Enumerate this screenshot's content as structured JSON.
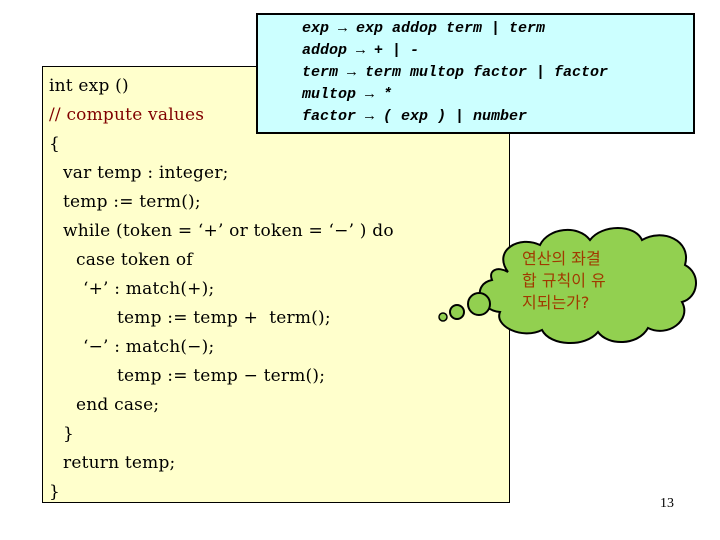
{
  "grammar": {
    "lines": [
      "exp → exp addop term | term",
      "addop → + | -",
      "term → term multop factor | factor",
      "multop → *",
      "factor → ( exp ) | number"
    ]
  },
  "code": {
    "lines": [
      {
        "text": "int exp ()",
        "indent": 0,
        "type": "code"
      },
      {
        "text": "// compute values",
        "indent": 0,
        "type": "comment"
      },
      {
        "text": "{",
        "indent": 0,
        "type": "code"
      },
      {
        "text": "var temp : integer;",
        "indent": 1,
        "type": "code"
      },
      {
        "text": "temp := term();",
        "indent": 1,
        "type": "code"
      },
      {
        "text": "while (token = ‘+’ or token = ‘−’ ) do",
        "indent": 1,
        "type": "code"
      },
      {
        "text": "case token of",
        "indent": 2,
        "type": "code"
      },
      {
        "text": "‘+’ : match(+);",
        "indent": 3,
        "type": "code"
      },
      {
        "text": "temp := temp +  term();",
        "indent": 5,
        "type": "code"
      },
      {
        "text": "‘−’ : match(−);",
        "indent": 3,
        "type": "code"
      },
      {
        "text": "temp := temp − term();",
        "indent": 5,
        "type": "code"
      },
      {
        "text": "end case;",
        "indent": 2,
        "type": "code"
      },
      {
        "text": "}",
        "indent": 1,
        "type": "code"
      },
      {
        "text": "return temp;",
        "indent": 1,
        "type": "code"
      },
      {
        "text": "}",
        "indent": 0,
        "type": "code"
      }
    ]
  },
  "callout": {
    "lines": [
      "연산의 좌결",
      "합 규칙이 유",
      "지되는가?"
    ],
    "fill_color": "#92D050",
    "text_color": "#A03A00"
  },
  "page_number": "13"
}
